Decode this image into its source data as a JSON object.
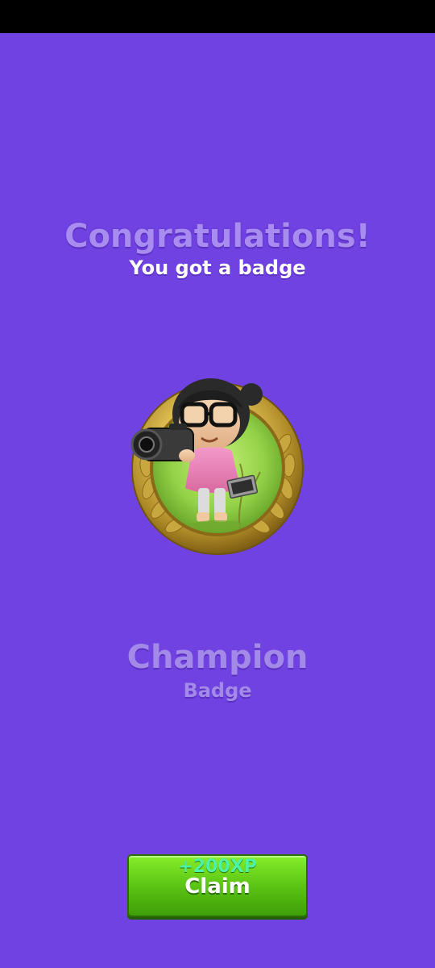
{
  "header": {
    "title": "Congratulations!",
    "subtitle": "You got a badge"
  },
  "badge": {
    "icon": "champion-badge-medal-icon",
    "name": "Champion",
    "type": "Badge"
  },
  "claim": {
    "xp": "+200XP",
    "label": "Claim"
  },
  "colors": {
    "background": "#7142e2",
    "title_text": "#a98cf0",
    "button_green": "#5fc916",
    "xp_text": "#4cf2a6"
  }
}
